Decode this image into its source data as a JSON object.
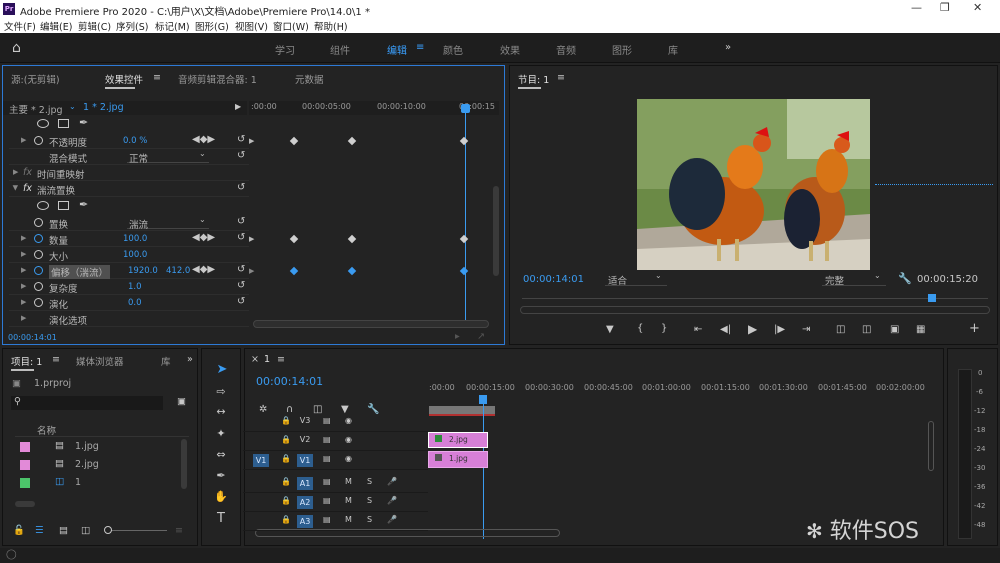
{
  "window": {
    "title": "Adobe Premiere Pro 2020 - C:\\用户\\X\\文档\\Adobe\\Premiere Pro\\14.0\\1 *",
    "logo": "Pr"
  },
  "menu": [
    "文件(F)",
    "编辑(E)",
    "剪辑(C)",
    "序列(S)",
    "标记(M)",
    "图形(G)",
    "视图(V)",
    "窗口(W)",
    "帮助(H)"
  ],
  "workspaces": [
    "学习",
    "组件",
    "编辑",
    "颜色",
    "效果",
    "音频",
    "图形",
    "库"
  ],
  "workspace_active": "编辑",
  "source_panel": {
    "tabs": [
      "源:(无剪辑)",
      "效果控件",
      "音频剪辑混合器: 1",
      "元数据"
    ],
    "active_tab": "效果控件",
    "master": "主要 * 2.jpg",
    "clip": "1 * 2.jpg",
    "ruler": [
      ":00:00",
      "00:00:05:00",
      "00:00:10:00",
      "00:00:15"
    ],
    "rows": [
      {
        "label": "不透明度",
        "value": "0.0 %"
      },
      {
        "label": "混合模式",
        "value": "正常"
      },
      {
        "label": "时间重映射",
        "value": ""
      },
      {
        "label": "湍流置换",
        "value": ""
      },
      {
        "label": "置换",
        "value": "湍流"
      },
      {
        "label": "数量",
        "value": "100.0"
      },
      {
        "label": "大小",
        "value": "100.0"
      },
      {
        "label": "偏移（湍流）",
        "value": "1920.0",
        "value2": "412.0"
      },
      {
        "label": "复杂度",
        "value": "1.0"
      },
      {
        "label": "演化",
        "value": "0.0"
      },
      {
        "label": "演化选项",
        "value": ""
      }
    ],
    "timecode": "00:00:14:01",
    "fx_label": "fx"
  },
  "program_panel": {
    "tab": "节目: 1",
    "timecode": "00:00:14:01",
    "fit": "适合",
    "quality": "完整",
    "duration": "00:00:15:20"
  },
  "project_panel": {
    "tabs": [
      "项目: 1",
      "媒体浏览器",
      "库"
    ],
    "file": "1.prproj",
    "header": "名称",
    "items": [
      {
        "name": "1.jpg",
        "color": "#e28ad8"
      },
      {
        "name": "2.jpg",
        "color": "#e28ad8"
      },
      {
        "name": "1",
        "color": "#4cc46a"
      }
    ]
  },
  "timeline": {
    "tab": "1",
    "timecode": "00:00:14:01",
    "ruler": [
      ":00:00",
      "00:00:15:00",
      "00:00:30:00",
      "00:00:45:00",
      "00:01:00:00",
      "00:01:15:00",
      "00:01:30:00",
      "00:01:45:00",
      "00:02:00:00"
    ],
    "tracks": [
      {
        "name": "V3",
        "type": "video"
      },
      {
        "name": "V2",
        "type": "video"
      },
      {
        "name": "V1",
        "type": "video",
        "source": "V1"
      },
      {
        "name": "A1",
        "type": "audio"
      },
      {
        "name": "A2",
        "type": "audio"
      },
      {
        "name": "A3",
        "type": "audio"
      }
    ],
    "audio_labels": {
      "mute": "M",
      "solo": "S"
    },
    "clips": [
      {
        "name": "2.jpg",
        "track": "V2"
      },
      {
        "name": "1.jpg",
        "track": "V1"
      }
    ]
  },
  "meter": [
    "0",
    "-6",
    "-12",
    "-18",
    "-24",
    "-30",
    "-36",
    "-42",
    "-48"
  ],
  "watermark": "软件SOS"
}
